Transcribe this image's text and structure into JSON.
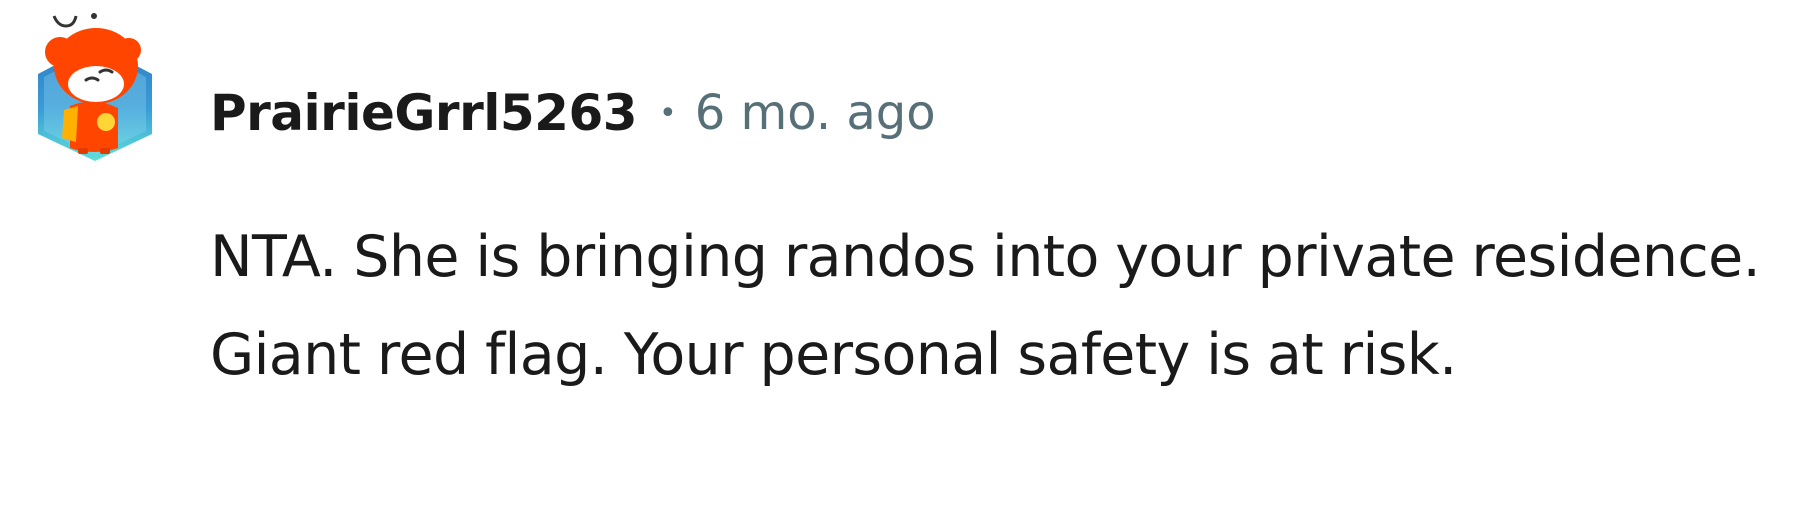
{
  "comment": {
    "author": "PrairieGrrl5263",
    "separator": "•",
    "timestamp": "6 mo. ago",
    "body": "NTA. She is bringing randos into your private residence. Giant red flag. Your personal safety is at risk.",
    "avatar": {
      "icon": "snoo-avatar-icon",
      "colors": {
        "head": "#ff4500",
        "frame_top": "#3a8fd0",
        "frame_bottom": "#5ee0d8",
        "body": "#ff4500",
        "badge": "#ffd635"
      }
    }
  },
  "colors": {
    "text_primary": "#1a1a1b",
    "text_secondary": "#576f76",
    "background": "#ffffff"
  }
}
